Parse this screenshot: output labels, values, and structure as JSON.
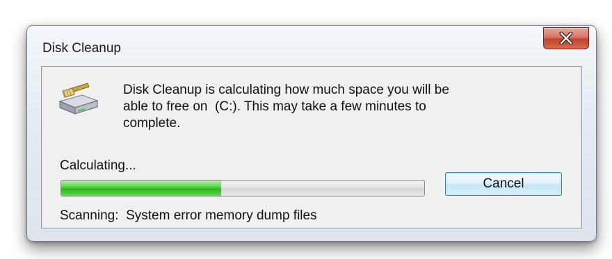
{
  "window": {
    "title": "Disk Cleanup",
    "close_icon": "close-x-icon"
  },
  "content": {
    "icon": "disk-cleanup-drive-icon",
    "message_line1": "Disk Cleanup is calculating how much space you will be",
    "message_line2": "able to free on  (C:). This may take a few minutes to",
    "message_line3": "complete.",
    "status_label": "Calculating...",
    "progress_fraction": 0.44,
    "cancel_label": "Cancel",
    "scanning_label": "Scanning:",
    "scanning_item": "System error memory dump files"
  },
  "colors": {
    "progress_fill": "#2bb61d",
    "close_button": "#c0432f",
    "button_border": "#3c7fb1"
  }
}
